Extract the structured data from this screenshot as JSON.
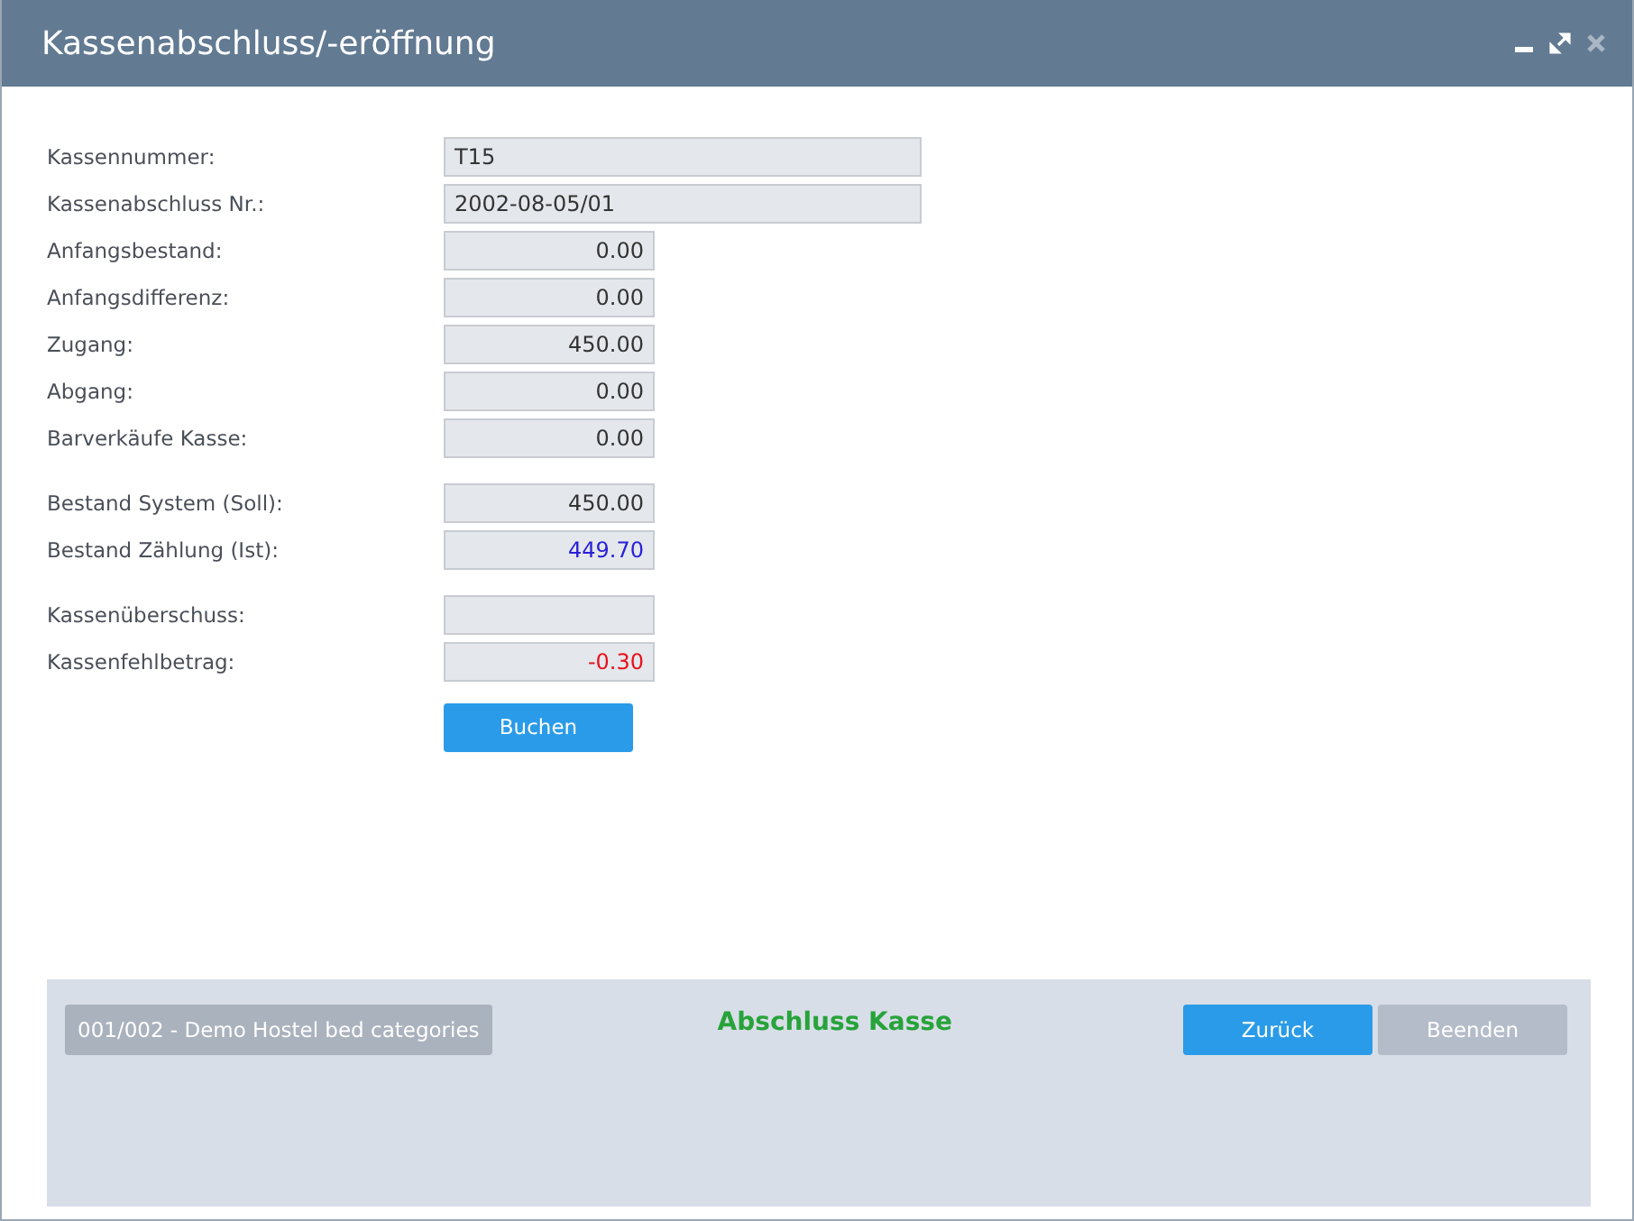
{
  "window": {
    "title": "Kassenabschluss/-eröffnung",
    "controls": [
      {
        "kind": "minimize"
      },
      {
        "kind": "maximize"
      },
      {
        "kind": "close",
        "disabled": true
      }
    ]
  },
  "form": {
    "groups": [
      [
        {
          "label": "Kassennummer:",
          "value": "T15",
          "kind": "wide",
          "color": "#333333"
        },
        {
          "label": "Kassenabschluss Nr.:",
          "value": "2002-08-05/01",
          "kind": "wide",
          "color": "#333333"
        },
        {
          "label": "Anfangsbestand:",
          "value": "0.00",
          "kind": "amount",
          "color": "#333333"
        },
        {
          "label": "Anfangsdifferenz:",
          "value": "0.00",
          "kind": "amount",
          "color": "#333333"
        },
        {
          "label": "Zugang:",
          "value": "450.00",
          "kind": "amount",
          "color": "#333333"
        },
        {
          "label": "Abgang:",
          "value": "0.00",
          "kind": "amount",
          "color": "#333333"
        },
        {
          "label": "Barverkäufe Kasse:",
          "value": "0.00",
          "kind": "amount",
          "color": "#333333"
        }
      ],
      [
        {
          "label": "Bestand System (Soll):",
          "value": "450.00",
          "kind": "amount",
          "color": "#333333"
        },
        {
          "label": "Bestand Zählung (Ist):",
          "value": "449.70",
          "kind": "amount",
          "color": "#2a20d8"
        }
      ],
      [
        {
          "label": "Kassenüberschuss:",
          "kind": "amount"
        },
        {
          "label": "Kassenfehlbetrag:",
          "value": "-0.30",
          "kind": "amount",
          "color": "#e8101c"
        }
      ]
    ],
    "button": "Buchen"
  },
  "footer": {
    "info": "001/002 - Demo Hostel bed categories",
    "status": "Abschluss Kasse",
    "buttons": [
      {
        "label": "Zurück",
        "disabled": false
      },
      {
        "label": "Beenden",
        "disabled": true
      }
    ]
  }
}
